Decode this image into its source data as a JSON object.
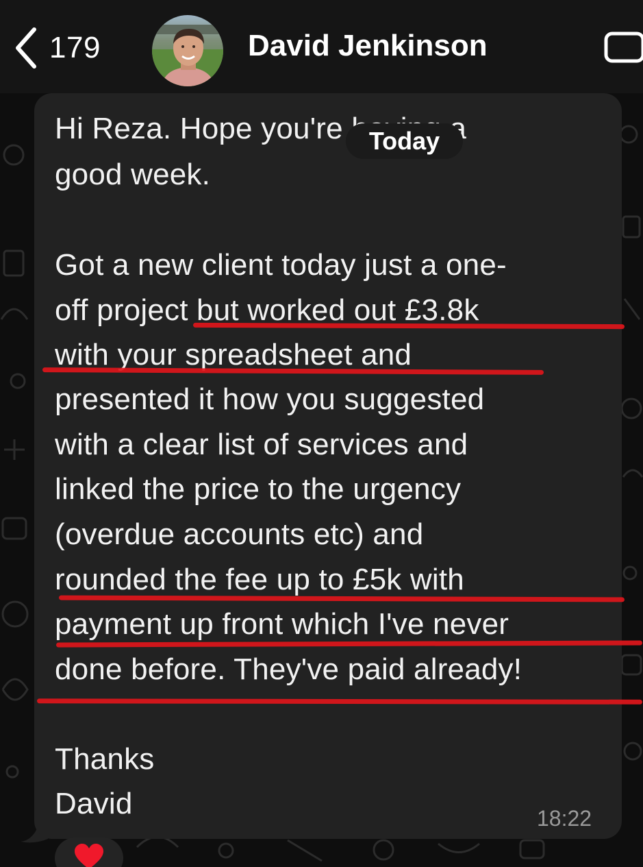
{
  "header": {
    "back_count": "179",
    "contact_name": "David Jenkinson",
    "back_icon": "chevron-left-icon",
    "video_icon": "video-call-icon"
  },
  "chat": {
    "date_separator": "Today",
    "message": {
      "lines": [
        "Hi Reza. Hope you're having a",
        "good week.",
        " Got a new client today just a one-",
        "off project but worked out £3.8k",
        "with your spreadsheet and",
        "presented it how you suggested",
        "with a clear list of services and",
        "linked the price to the urgency",
        "(overdue accounts etc) and",
        "rounded the fee up to £5k with",
        "payment up front which I've never",
        "done before. They've paid already!",
        "Thanks",
        "David"
      ],
      "time": "18:22"
    },
    "reaction": {
      "emoji": "❤️",
      "icon": "red-heart-icon"
    }
  },
  "colors": {
    "bubble": "#222222",
    "header": "#151515",
    "highlight": "#e0161b",
    "text": "#f2f2f2",
    "timestamp": "#9a9a9a"
  }
}
